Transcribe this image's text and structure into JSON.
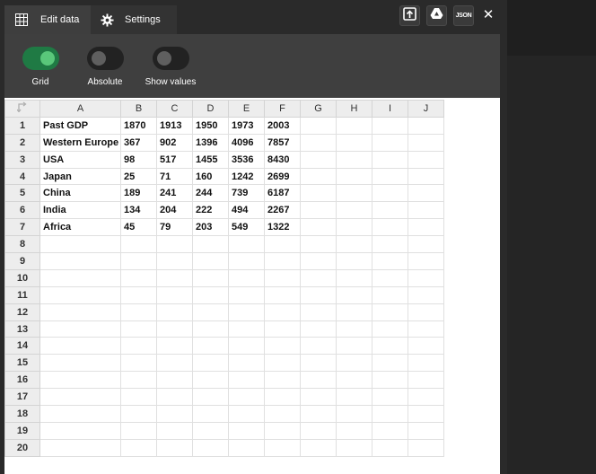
{
  "tabs": [
    {
      "label": "Edit data",
      "icon": "table-icon",
      "active": true
    },
    {
      "label": "Settings",
      "icon": "gear-icon",
      "active": false
    }
  ],
  "top_buttons": {
    "upload_icon": "upload-icon",
    "drive_icon": "drive-icon",
    "json_label": "JSON",
    "close_label": "✕"
  },
  "toggles": [
    {
      "label": "Grid",
      "on": true
    },
    {
      "label": "Absolute",
      "on": false
    },
    {
      "label": "Show values",
      "on": false
    }
  ],
  "sheet": {
    "columns": [
      "A",
      "B",
      "C",
      "D",
      "E",
      "F",
      "G",
      "H",
      "I",
      "J"
    ],
    "row_count": 20,
    "rows": [
      [
        "Past GDP",
        "1870",
        "1913",
        "1950",
        "1973",
        "2003"
      ],
      [
        "Western Europe",
        "367",
        "902",
        "1396",
        "4096",
        "7857"
      ],
      [
        "USA",
        "98",
        "517",
        "1455",
        "3536",
        "8430"
      ],
      [
        "Japan",
        "25",
        "71",
        "160",
        "1242",
        "2699"
      ],
      [
        "China",
        "189",
        "241",
        "244",
        "739",
        "6187"
      ],
      [
        "India",
        "134",
        "204",
        "222",
        "494",
        "2267"
      ],
      [
        "Africa",
        "45",
        "79",
        "203",
        "549",
        "1322"
      ]
    ]
  },
  "colors": {
    "toggle_on": "#1f7a44",
    "toggle_knob_on": "#59c77a",
    "panel_bg": "#2a2a2a",
    "toolbar_bg": "#3f3f3f"
  }
}
